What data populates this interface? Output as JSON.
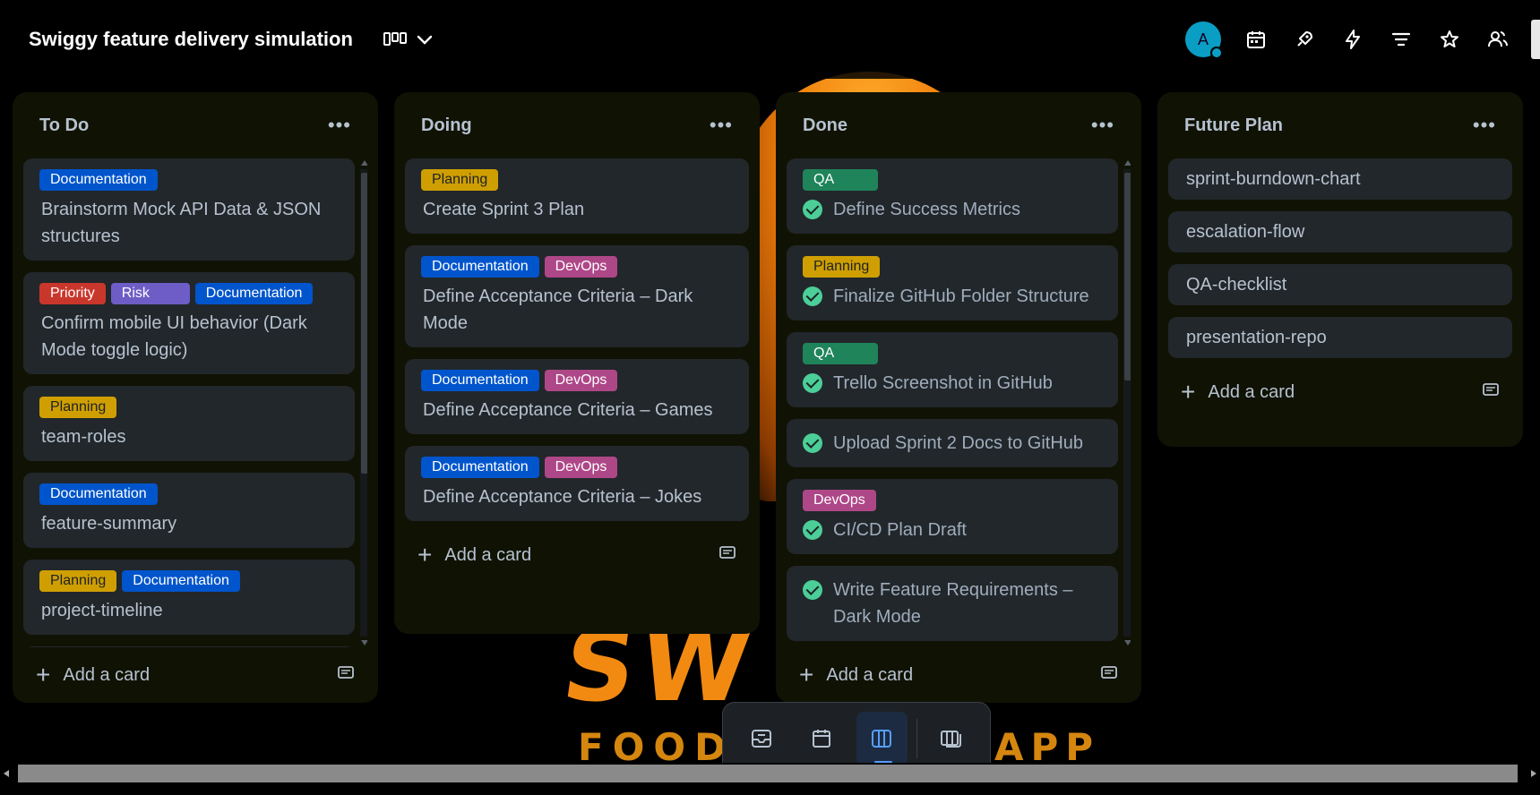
{
  "board": {
    "title": "Swiggy feature delivery simulation",
    "avatar_initial": "A"
  },
  "background": {
    "logo_text": "SW",
    "food_text": "FOOD",
    "app_text": "APP"
  },
  "header": {
    "icons": [
      "board-view-icon",
      "chevron-down-icon",
      "calendar-icon",
      "power-ups-icon",
      "automation-icon",
      "filter-icon",
      "star-icon",
      "share-icon"
    ]
  },
  "lists": [
    {
      "title": "To Do",
      "add_label": "Add a card",
      "cards": [
        {
          "labels": [
            {
              "text": "Documentation",
              "type": "doc"
            }
          ],
          "title": "Brainstorm Mock API Data & JSON structures"
        },
        {
          "labels": [
            {
              "text": "Priority",
              "type": "priority"
            },
            {
              "text": "Risk",
              "type": "risk"
            },
            {
              "text": "Documentation",
              "type": "doc"
            }
          ],
          "title": "Confirm mobile UI behavior (Dark Mode toggle logic)"
        },
        {
          "labels": [
            {
              "text": "Planning",
              "type": "planning"
            }
          ],
          "title": "team-roles"
        },
        {
          "labels": [
            {
              "text": "Documentation",
              "type": "doc"
            }
          ],
          "title": "feature-summary"
        },
        {
          "labels": [
            {
              "text": "Planning",
              "type": "planning"
            },
            {
              "text": "Documentation",
              "type": "doc"
            }
          ],
          "title": "project-timeline"
        }
      ]
    },
    {
      "title": "Doing",
      "add_label": "Add a card",
      "cards": [
        {
          "labels": [
            {
              "text": "Planning",
              "type": "planning"
            }
          ],
          "title": "Create Sprint 3 Plan"
        },
        {
          "labels": [
            {
              "text": "Documentation",
              "type": "doc"
            },
            {
              "text": "DevOps",
              "type": "devops"
            }
          ],
          "title": "Define Acceptance Criteria – Dark Mode"
        },
        {
          "labels": [
            {
              "text": "Documentation",
              "type": "doc"
            },
            {
              "text": "DevOps",
              "type": "devops"
            }
          ],
          "title": "Define Acceptance Criteria – Games"
        },
        {
          "labels": [
            {
              "text": "Documentation",
              "type": "doc"
            },
            {
              "text": "DevOps",
              "type": "devops"
            }
          ],
          "title": "Define Acceptance Criteria – Jokes"
        }
      ]
    },
    {
      "title": "Done",
      "add_label": "Add a card",
      "cards": [
        {
          "labels": [
            {
              "text": "QA",
              "type": "qa"
            }
          ],
          "title": "Define Success Metrics",
          "done": true
        },
        {
          "labels": [
            {
              "text": "Planning",
              "type": "planning"
            }
          ],
          "title": "Finalize GitHub Folder Structure",
          "done": true
        },
        {
          "labels": [
            {
              "text": "QA",
              "type": "qa"
            }
          ],
          "title": "Trello Screenshot in GitHub",
          "done": true
        },
        {
          "labels": [],
          "title": "Upload Sprint 2 Docs to GitHub",
          "done": true
        },
        {
          "labels": [
            {
              "text": "DevOps",
              "type": "devops"
            }
          ],
          "title": "CI/CD Plan Draft",
          "done": true
        },
        {
          "labels": [],
          "title": "Write Feature Requirements – Dark Mode",
          "done": true
        }
      ]
    },
    {
      "title": "Future Plan",
      "add_label": "Add a card",
      "cards": [
        {
          "labels": [],
          "title": "sprint-burndown-chart"
        },
        {
          "labels": [],
          "title": "escalation-flow"
        },
        {
          "labels": [],
          "title": "QA-checklist"
        },
        {
          "labels": [],
          "title": "presentation-repo"
        }
      ]
    }
  ],
  "bottom_bar": {
    "items": [
      "inbox-icon",
      "planner-icon",
      "board-icon",
      "switch-boards-icon"
    ],
    "active": "board-icon"
  }
}
